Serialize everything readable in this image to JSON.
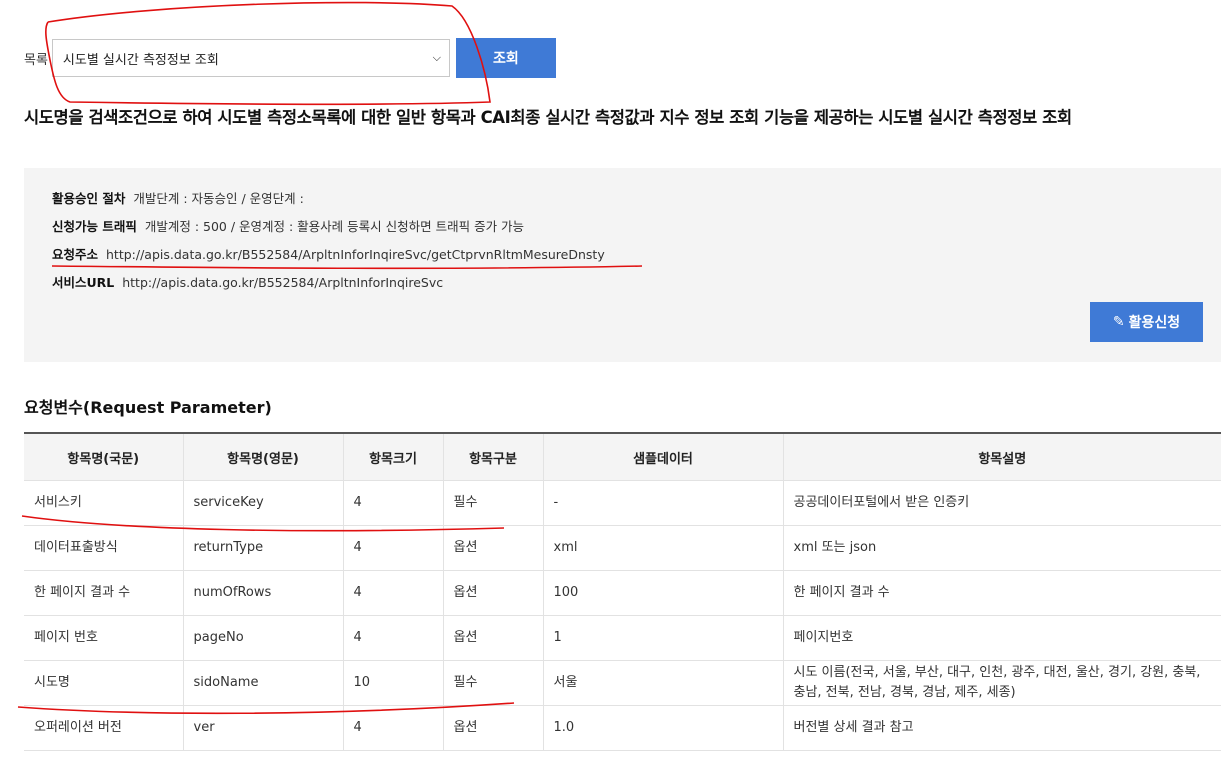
{
  "filter": {
    "label": "목록",
    "selected": "시도별 실시간 측정정보 조회",
    "query_button": "조회"
  },
  "headline": "시도명을 검색조건으로 하여 시도별 측정소목록에 대한 일반 항목과 CAI최종 실시간 측정값과 지수 정보 조회 기능을 제공하는 시도별 실시간 측정정보 조회",
  "info": {
    "approval": {
      "label": "활용승인 절차",
      "value": "개발단계 : 자동승인 / 운영단계 :"
    },
    "traffic": {
      "label": "신청가능 트래픽",
      "value": "개발계정 : 500 / 운영계정 : 활용사례 등록시 신청하면 트래픽 증가 가능"
    },
    "request_url": {
      "label": "요청주소",
      "value": "http://apis.data.go.kr/B552584/ArpltnInforInqireSvc/getCtprvnRltmMesureDnsty"
    },
    "service_url": {
      "label": "서비스URL",
      "value": "http://apis.data.go.kr/B552584/ArpltnInforInqireSvc"
    },
    "apply_button": "활용신청"
  },
  "section_title": "요청변수(Request Parameter)",
  "table": {
    "headers": [
      "항목명(국문)",
      "항목명(영문)",
      "항목크기",
      "항목구분",
      "샘플데이터",
      "항목설명"
    ],
    "rows": [
      [
        "서비스키",
        "serviceKey",
        "4",
        "필수",
        "-",
        "공공데이터포털에서 받은 인증키"
      ],
      [
        "데이터표출방식",
        "returnType",
        "4",
        "옵션",
        "xml",
        "xml 또는 json"
      ],
      [
        "한 페이지 결과 수",
        "numOfRows",
        "4",
        "옵션",
        "100",
        "한 페이지 결과 수"
      ],
      [
        "페이지 번호",
        "pageNo",
        "4",
        "옵션",
        "1",
        "페이지번호"
      ],
      [
        "시도명",
        "sidoName",
        "10",
        "필수",
        "서울",
        "시도 이름(전국, 서울, 부산, 대구, 인천, 광주, 대전, 울산, 경기, 강원, 충북, 충남, 전북, 전남, 경북, 경남, 제주, 세종)"
      ],
      [
        "오퍼레이션 버전",
        "ver",
        "4",
        "옵션",
        "1.0",
        "버전별 상세 결과 참고"
      ]
    ]
  },
  "colors": {
    "accent": "#3f7ad6",
    "annotation": "#e01010",
    "panel": "#f4f4f4"
  }
}
